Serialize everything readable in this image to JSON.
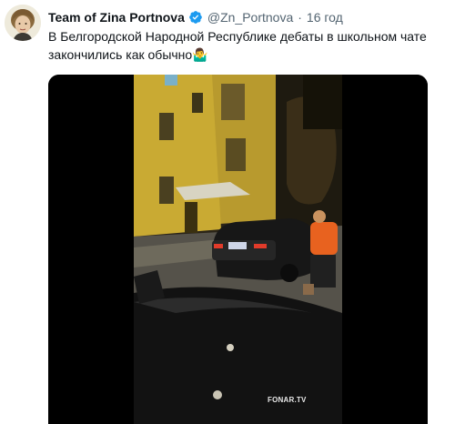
{
  "tweet": {
    "author_name": "Team of Zina Portnova",
    "handle": "@Zn_Portnova",
    "separator": "·",
    "time": "16 год",
    "text": "В Белгородской Народной Республике дебаты в школьном чате закончились как обычно",
    "emoji": "🤷‍♂️",
    "verified_icon": "verified-badge-icon",
    "accent_color": "#1d9bf0"
  },
  "video": {
    "watermark": "FONAR.TV"
  }
}
